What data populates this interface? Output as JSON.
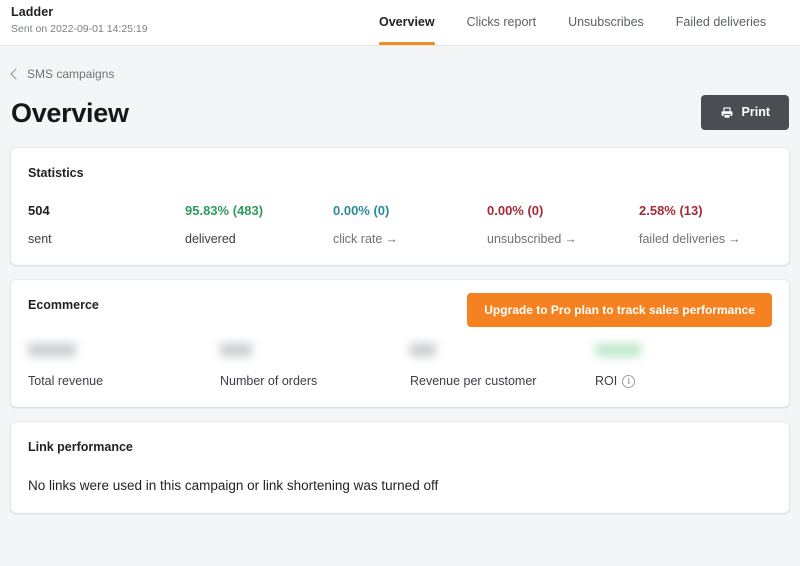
{
  "topbar": {
    "campaign_name": "Ladder",
    "sent_on": "Sent on 2022-09-01 14:25:19",
    "tabs": [
      {
        "label": "Overview",
        "active": true
      },
      {
        "label": "Clicks report",
        "active": false
      },
      {
        "label": "Unsubscribes",
        "active": false
      },
      {
        "label": "Failed deliveries",
        "active": false
      }
    ]
  },
  "breadcrumb": {
    "label": "SMS campaigns",
    "icon": "chevron-left-icon"
  },
  "header": {
    "title": "Overview",
    "print_label": "Print",
    "print_icon": "printer-icon"
  },
  "statistics": {
    "title": "Statistics",
    "items": [
      {
        "value": "504",
        "label": "sent",
        "color": "#1f2124",
        "arrow": ""
      },
      {
        "value": "95.83% (483)",
        "label": "delivered",
        "color": "#2e9b5e",
        "arrow": ""
      },
      {
        "value": "0.00% (0)",
        "label": "click rate",
        "color": "#2b8a9e",
        "arrow": "→"
      },
      {
        "value": "0.00% (0)",
        "label": "unsubscribed",
        "color": "#a32c35",
        "arrow": "→"
      },
      {
        "value": "2.58% (13)",
        "label": "failed deliveries",
        "color": "#a32c35",
        "arrow": "→"
      }
    ]
  },
  "ecommerce": {
    "title": "Ecommerce",
    "upgrade_label": "Upgrade to Pro plan to track sales performance",
    "upgrade_color": "#f58220",
    "items": [
      {
        "label": "Total revenue",
        "value_hidden": true,
        "blur_width": 48,
        "blur_tone": "grey",
        "info": false
      },
      {
        "label": "Number of orders",
        "value_hidden": true,
        "blur_width": 32,
        "blur_tone": "grey",
        "info": false
      },
      {
        "label": "Revenue per customer",
        "value_hidden": true,
        "blur_width": 26,
        "blur_tone": "grey",
        "info": false
      },
      {
        "label": "ROI",
        "value_hidden": true,
        "blur_width": 46,
        "blur_tone": "green",
        "info": true,
        "info_icon": "info-circle-icon"
      }
    ]
  },
  "link_performance": {
    "title": "Link performance",
    "empty_message": "No links were used in this campaign or link shortening was turned off"
  }
}
